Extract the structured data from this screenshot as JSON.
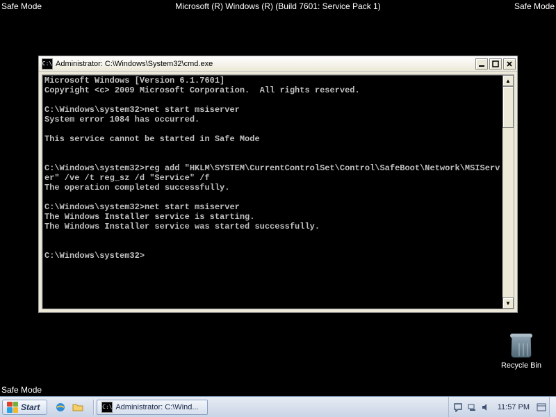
{
  "safemode": {
    "corner_label": "Safe Mode",
    "top_center": "Microsoft (R) Windows (R) (Build 7601: Service Pack 1)"
  },
  "cmd": {
    "title": "Administrator: C:\\Windows\\System32\\cmd.exe",
    "output": "Microsoft Windows [Version 6.1.7601]\nCopyright <c> 2009 Microsoft Corporation.  All rights reserved.\n\nC:\\Windows\\system32>net start msiserver\nSystem error 1084 has occurred.\n\nThis service cannot be started in Safe Mode\n\n\nC:\\Windows\\system32>reg add \"HKLM\\SYSTEM\\CurrentControlSet\\Control\\SafeBoot\\Network\\MSIServer\" /ve /t reg_sz /d \"Service\" /f\nThe operation completed successfully.\n\nC:\\Windows\\system32>net start msiserver\nThe Windows Installer service is starting.\nThe Windows Installer service was started successfully.\n\n\nC:\\Windows\\system32>"
  },
  "recycle_bin": {
    "label": "Recycle Bin"
  },
  "taskbar": {
    "start_label": "Start",
    "task_label": "Administrator: C:\\Wind...",
    "clock": "11:57 PM"
  }
}
